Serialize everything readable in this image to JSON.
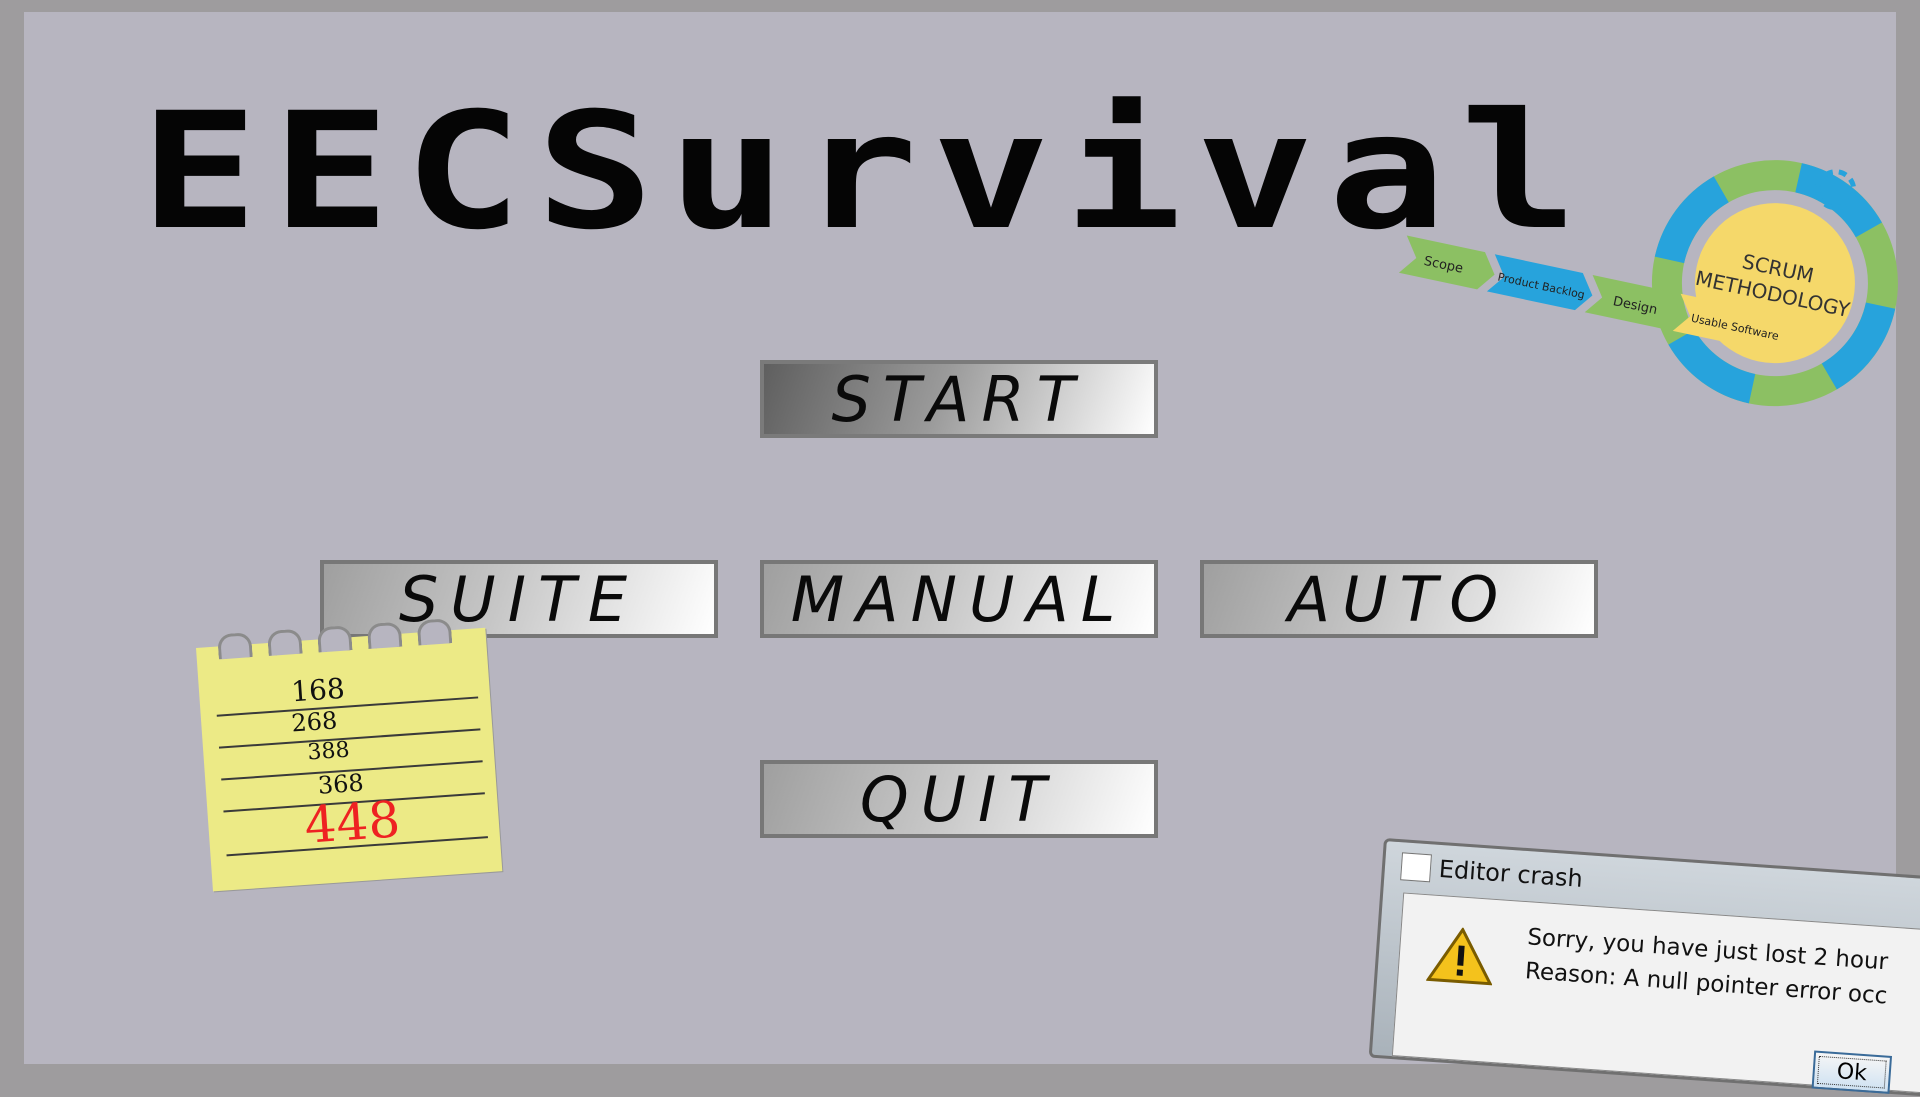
{
  "game": {
    "title": "EECSurvival"
  },
  "menu": {
    "start": "START",
    "suite": "SUITE",
    "manual": "MANUAL",
    "auto": "AUTO",
    "quit": "QUIT"
  },
  "notepad": {
    "numbers": [
      "168",
      "268",
      "388",
      "368"
    ],
    "highlight": "448"
  },
  "scrum": {
    "center_line1": "SCRUM",
    "center_line2": "METHODOLOGY",
    "stages": [
      "Scope",
      "Product Backlog",
      "Design",
      "Usable Software"
    ]
  },
  "dialog": {
    "title": "Editor crash",
    "message_line1": "Sorry, you have just lost 2 hour",
    "message_line2": "Reason: A null pointer error occ",
    "ok_label": "Ok"
  }
}
